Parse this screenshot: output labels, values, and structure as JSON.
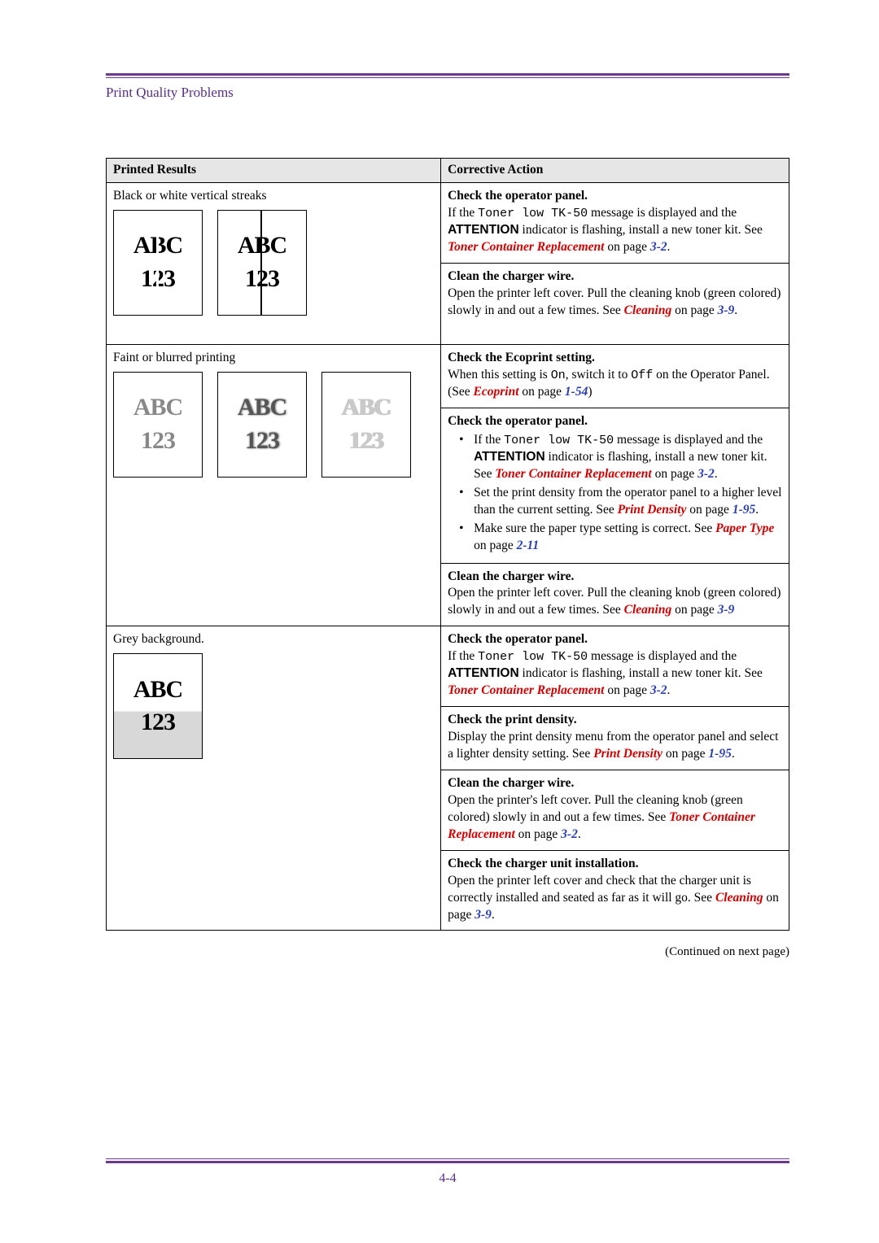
{
  "section_title": "Print Quality Problems",
  "header_left": "Printed Results",
  "header_right": "Corrective Action",
  "row1": {
    "caption": "Black or white vertical streaks",
    "action1": {
      "title": "Check the operator panel.",
      "pre": "If the ",
      "mono": "Toner low TK-50",
      "post1": " message is displayed and the ",
      "attn": "ATTENTION",
      "post2": " indicator is flashing, install a new toner kit. See ",
      "link": "Toner Container Replacement",
      "onpage": " on page ",
      "page": "3-2",
      "end": "."
    },
    "action2": {
      "title": "Clean the charger wire.",
      "body1": "Open the printer left cover. Pull the cleaning knob (green colored) slowly in and out a few times. See ",
      "link": "Cleaning",
      "onpage": " on page ",
      "page": "3-9",
      "end": "."
    }
  },
  "row2": {
    "caption": "Faint or blurred printing",
    "action1": {
      "title": "Check the Ecoprint setting.",
      "pre": "When this setting is ",
      "mono1": "On",
      "mid": ", switch it to ",
      "mono2": "Off",
      "post": " on the Operator Panel. (See ",
      "link": "Ecoprint",
      "onpage": " on page ",
      "page": "1-54",
      "end": ")"
    },
    "action2": {
      "title": "Check the operator panel.",
      "b1_pre": "If the ",
      "b1_mono": "Toner low TK-50",
      "b1_mid": " message is displayed and the ",
      "b1_attn": "ATTENTION",
      "b1_post": " indicator is flashing, install a new toner kit. See ",
      "b1_link": "Toner Container Replacement",
      "b1_onpage": " on page ",
      "b1_page": "3-2",
      "b1_end": ".",
      "b2_pre": "Set the print density from the operator panel to a higher level than the current setting. See ",
      "b2_link": "Print Density",
      "b2_onpage": " on page ",
      "b2_page": "1-95",
      "b2_end": ".",
      "b3_pre": "Make sure the paper type setting is correct. See ",
      "b3_link": "Paper Type",
      "b3_onpage": " on page ",
      "b3_page": "2-11"
    },
    "action3": {
      "title": "Clean the charger wire.",
      "body": "Open the printer left cover. Pull the cleaning knob (green colored) slowly in and out a few times. See ",
      "link": "Cleaning",
      "onpage": " on page ",
      "page": "3-9"
    }
  },
  "row3": {
    "caption": "Grey background.",
    "action1": {
      "title": "Check the operator panel.",
      "pre": "If the ",
      "mono": "Toner low TK-50",
      "mid": " message is displayed and the ",
      "attn": "ATTENTION",
      "post": " indicator is flashing, install a new toner kit. See ",
      "link": "Toner Container Replacement",
      "onpage": " on page ",
      "page": "3-2",
      "end": "."
    },
    "action2": {
      "title": "Check the print density.",
      "body": "Display the print density menu from the operator panel and select a lighter density setting. See ",
      "link": "Print Density",
      "onpage": " on page ",
      "page": "1-95",
      "end": "."
    },
    "action3": {
      "title": "Clean the charger wire.",
      "body": "Open the printer's left cover. Pull the cleaning knob (green colored) slowly in and out a few times. See ",
      "link": "Toner Container Replacement",
      "onpage": " on page ",
      "page": "3-2",
      "end": "."
    },
    "action4": {
      "title": "Check the charger unit installation.",
      "body": "Open the printer left cover and check that the charger unit is correctly installed and seated as far as it will go. See ",
      "link": "Cleaning",
      "onpage": " on page ",
      "page": "3-9",
      "end": "."
    }
  },
  "sample_text": {
    "l1": "ABC",
    "l2": "123"
  },
  "continued": "(Continued on next page)",
  "page_number": "4-4"
}
